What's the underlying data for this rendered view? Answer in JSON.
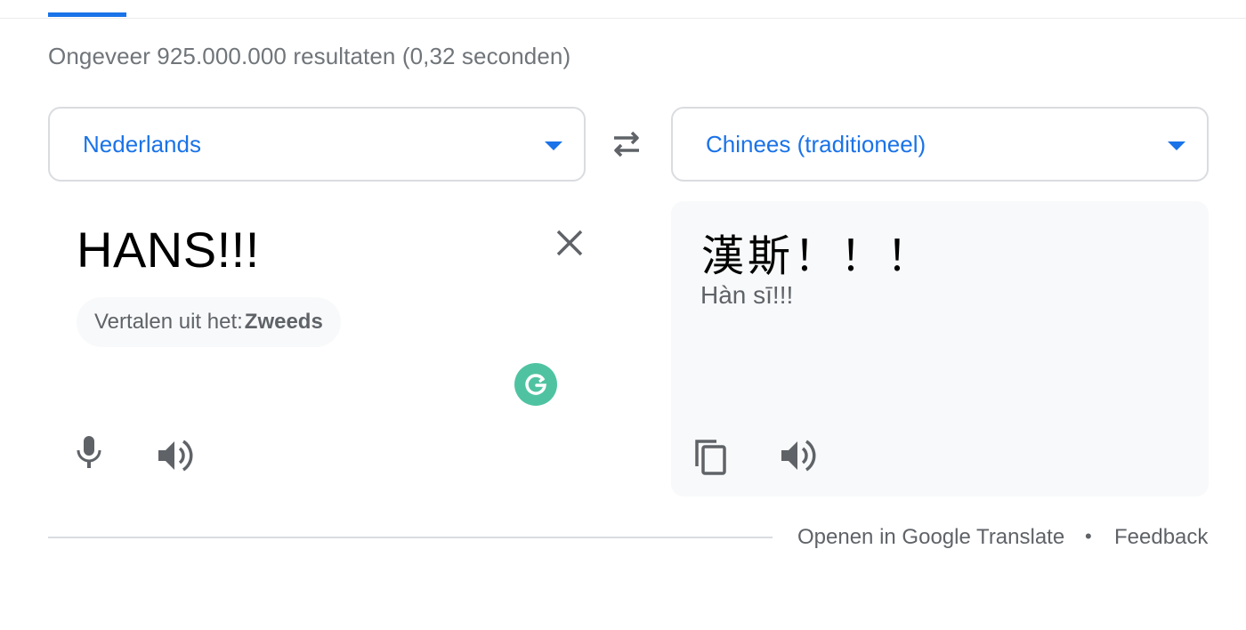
{
  "results": {
    "stats": "Ongeveer 925.000.000 resultaten (0,32 seconden)"
  },
  "translator": {
    "source_language": "Nederlands",
    "target_language": "Chinees (traditioneel)",
    "source_text": "HANS!!!",
    "target_text": "漢斯！！！",
    "romanization": "Hàn sī!!!",
    "detected": {
      "prefix": "Vertalen uit het:",
      "language": "Zweeds"
    }
  },
  "footer": {
    "open_link": "Openen in Google Translate",
    "separator": "•",
    "feedback_link": "Feedback"
  },
  "colors": {
    "accent": "#1a73e8",
    "grammarly": "#4fc3a1",
    "target_panel_bg": "#f8f9fa",
    "border": "#dadce0"
  },
  "icons": {
    "swap": "swap-arrows-icon",
    "clear": "close-icon",
    "grammarly": "grammarly-icon",
    "mic": "microphone-icon",
    "speaker": "speaker-icon",
    "copy": "copy-icon"
  }
}
